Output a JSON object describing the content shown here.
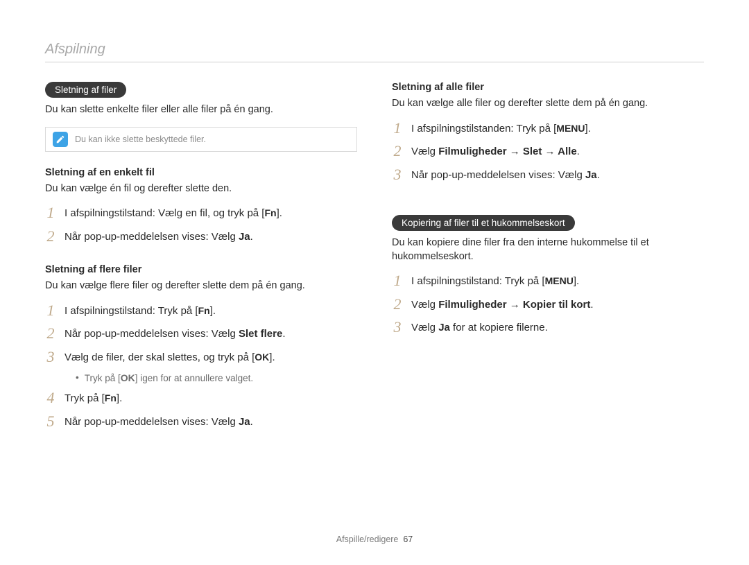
{
  "page_title": "Afspilning",
  "footer_section": "Afspille/redigere",
  "footer_page": "67",
  "left": {
    "section1": {
      "heading": "Sletning af filer",
      "desc": "Du kan slette enkelte filer eller alle filer på én gang.",
      "note": "Du kan ikke slette beskyttede filer."
    },
    "section2": {
      "heading": "Sletning af en enkelt fil",
      "desc": "Du kan vælge én fil og derefter slette den.",
      "step1_a": "I afspilningstilstand: Vælg en fil, og tryk på [",
      "step1_btn": "Fn",
      "step1_b": "].",
      "step2_a": "Når pop-up-meddelelsen vises: Vælg ",
      "step2_bold": "Ja",
      "step2_b": "."
    },
    "section3": {
      "heading": "Sletning af flere filer",
      "desc": "Du kan vælge flere filer og derefter slette dem på én gang.",
      "step1_a": "I afspilningstilstand: Tryk på [",
      "step1_btn": "Fn",
      "step1_b": "].",
      "step2_a": "Når pop-up-meddelelsen vises: Vælg ",
      "step2_bold": "Slet flere",
      "step2_b": ".",
      "step3_a": "Vælg de filer, der skal slettes, og tryk på [",
      "step3_btn": "OK",
      "step3_b": "].",
      "step3_sub_a": "Tryk på [",
      "step3_sub_btn": "OK",
      "step3_sub_b": "] igen for at annullere valget.",
      "step4_a": "Tryk på [",
      "step4_btn": "Fn",
      "step4_b": "].",
      "step5_a": "Når pop-up-meddelelsen vises: Vælg ",
      "step5_bold": "Ja",
      "step5_b": "."
    }
  },
  "right": {
    "section1": {
      "heading": "Sletning af alle filer",
      "desc": "Du kan vælge alle filer og derefter slette dem på én gang.",
      "step1_a": "I afspilningstilstanden: Tryk på [",
      "step1_btn": "MENU",
      "step1_b": "].",
      "step2_a": "Vælg ",
      "step2_bold": "Filmuligheder → Slet → Alle",
      "step2_b": ".",
      "step3_a": "Når pop-up-meddelelsen vises: Vælg ",
      "step3_bold": "Ja",
      "step3_b": "."
    },
    "section2": {
      "heading": "Kopiering af filer til et hukommelseskort",
      "desc": "Du kan kopiere dine filer fra den interne hukommelse til et hukommelseskort.",
      "step1_a": "I afspilningstilstand: Tryk på [",
      "step1_btn": "MENU",
      "step1_b": "].",
      "step2_a": "Vælg ",
      "step2_bold": "Filmuligheder → Kopier til kort",
      "step2_b": ".",
      "step3_a": "Vælg ",
      "step3_bold": "Ja",
      "step3_b": " for at kopiere filerne."
    }
  }
}
